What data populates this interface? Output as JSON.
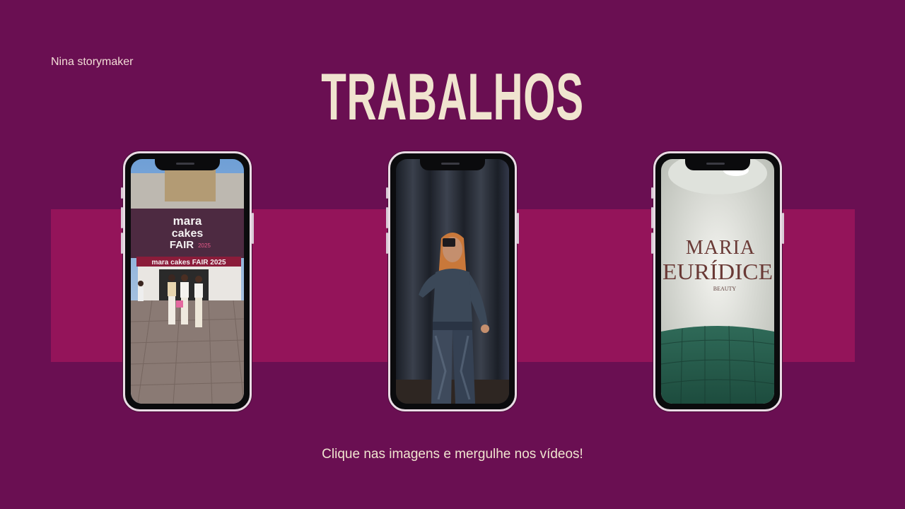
{
  "brand": "Nina storymaker",
  "title": "TRABALHOS",
  "caption": "Clique nas imagens e mergulhe nos vídeos!",
  "colors": {
    "background": "#6a0f52",
    "band": "#94145a",
    "title": "#f0e4cf",
    "frame": "#e9dbe4"
  },
  "phones": [
    {
      "scene": "fair-entrance",
      "sign_line1": "mara",
      "sign_line2": "cakes",
      "sign_line3": "FAIR",
      "sign_year": "2025",
      "banner": "mara cakes FAIR 2025"
    },
    {
      "scene": "woman-posing-curtain"
    },
    {
      "scene": "salon-wall-sign",
      "logo_line1": "MARIA",
      "logo_line2": "EURÍDICE",
      "logo_line3": "BEAUTY"
    }
  ]
}
